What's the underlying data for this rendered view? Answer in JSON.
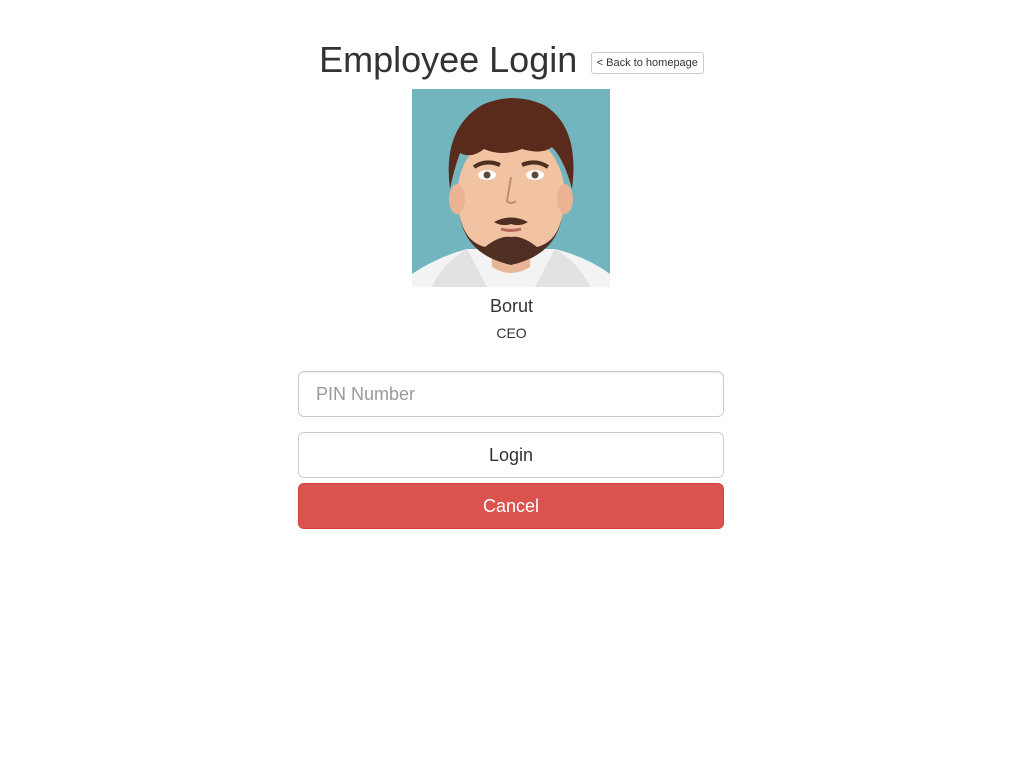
{
  "page": {
    "title": "Employee Login",
    "back_label": "< Back to homepage"
  },
  "employee": {
    "name": "Borut",
    "role": "CEO",
    "avatar_background": "#72b5bf"
  },
  "form": {
    "pin_placeholder": "PIN Number",
    "pin_value": "",
    "login_label": "Login",
    "cancel_label": "Cancel"
  },
  "colors": {
    "cancel_button": "#d9534f",
    "text": "#333333"
  }
}
